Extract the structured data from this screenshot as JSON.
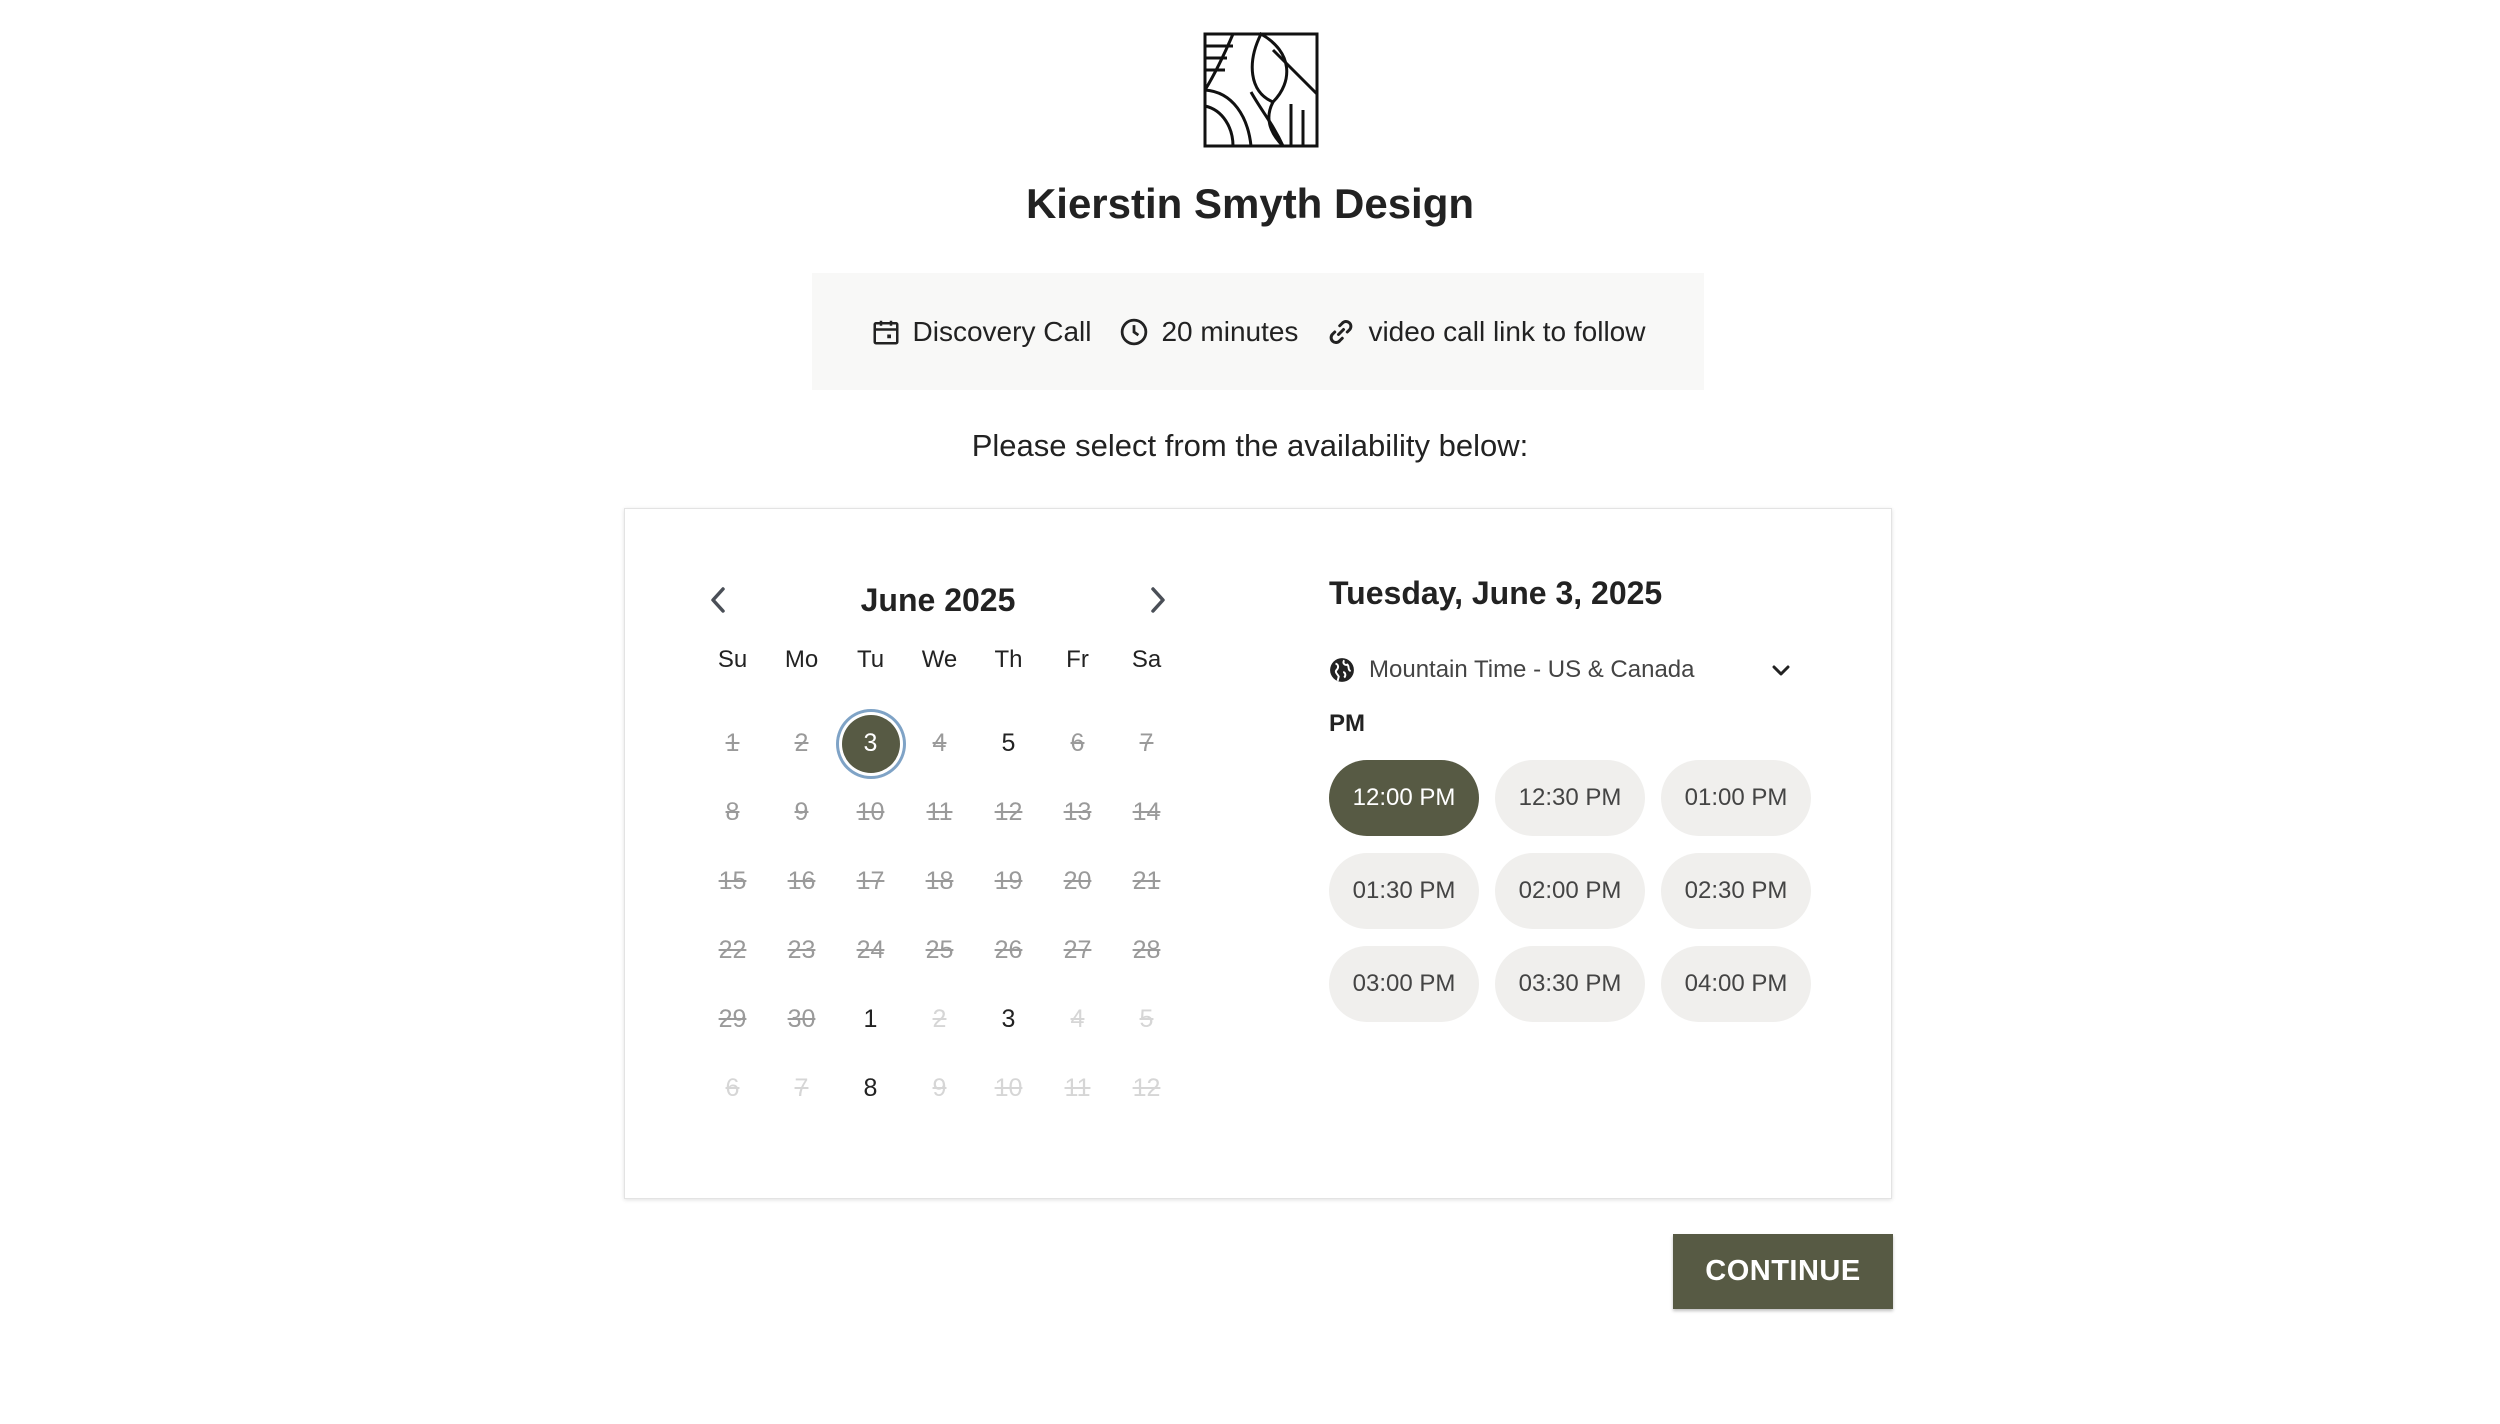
{
  "brand": {
    "name": "Kierstin Smyth Design",
    "logo_icon": "geometric-monogram-logo"
  },
  "meeting": {
    "type_icon": "calendar-icon",
    "type": "Discovery Call",
    "duration_icon": "clock-icon",
    "duration": "20 minutes",
    "location_icon": "link-icon",
    "location": "video call link to follow"
  },
  "instruction": "Please select from the availability below:",
  "calendar": {
    "month_label": "June 2025",
    "prev_icon": "chevron-left-icon",
    "next_icon": "chevron-right-icon",
    "weekdays": [
      "Su",
      "Mo",
      "Tu",
      "We",
      "Th",
      "Fr",
      "Sa"
    ],
    "days": [
      {
        "label": "1",
        "state": "unavail",
        "month": "current"
      },
      {
        "label": "2",
        "state": "unavail",
        "month": "current"
      },
      {
        "label": "3",
        "state": "selected",
        "month": "current"
      },
      {
        "label": "4",
        "state": "unavail",
        "month": "current"
      },
      {
        "label": "5",
        "state": "avail",
        "month": "current"
      },
      {
        "label": "6",
        "state": "unavail",
        "month": "current"
      },
      {
        "label": "7",
        "state": "unavail",
        "month": "current"
      },
      {
        "label": "8",
        "state": "unavail",
        "month": "current"
      },
      {
        "label": "9",
        "state": "unavail",
        "month": "current"
      },
      {
        "label": "10",
        "state": "unavail",
        "month": "current"
      },
      {
        "label": "11",
        "state": "unavail",
        "month": "current"
      },
      {
        "label": "12",
        "state": "unavail",
        "month": "current"
      },
      {
        "label": "13",
        "state": "unavail",
        "month": "current"
      },
      {
        "label": "14",
        "state": "unavail",
        "month": "current"
      },
      {
        "label": "15",
        "state": "unavail",
        "month": "current"
      },
      {
        "label": "16",
        "state": "unavail",
        "month": "current"
      },
      {
        "label": "17",
        "state": "unavail",
        "month": "current"
      },
      {
        "label": "18",
        "state": "unavail",
        "month": "current"
      },
      {
        "label": "19",
        "state": "unavail",
        "month": "current"
      },
      {
        "label": "20",
        "state": "unavail",
        "month": "current"
      },
      {
        "label": "21",
        "state": "unavail",
        "month": "current"
      },
      {
        "label": "22",
        "state": "unavail",
        "month": "current"
      },
      {
        "label": "23",
        "state": "unavail",
        "month": "current"
      },
      {
        "label": "24",
        "state": "unavail",
        "month": "current"
      },
      {
        "label": "25",
        "state": "unavail",
        "month": "current"
      },
      {
        "label": "26",
        "state": "unavail",
        "month": "current"
      },
      {
        "label": "27",
        "state": "unavail",
        "month": "current"
      },
      {
        "label": "28",
        "state": "unavail",
        "month": "current"
      },
      {
        "label": "29",
        "state": "unavail",
        "month": "current"
      },
      {
        "label": "30",
        "state": "unavail",
        "month": "current"
      },
      {
        "label": "1",
        "state": "avail",
        "month": "other"
      },
      {
        "label": "2",
        "state": "unavail",
        "month": "other"
      },
      {
        "label": "3",
        "state": "avail",
        "month": "other"
      },
      {
        "label": "4",
        "state": "unavail",
        "month": "other"
      },
      {
        "label": "5",
        "state": "unavail",
        "month": "other"
      },
      {
        "label": "6",
        "state": "unavail",
        "month": "other"
      },
      {
        "label": "7",
        "state": "unavail",
        "month": "other"
      },
      {
        "label": "8",
        "state": "avail",
        "month": "other"
      },
      {
        "label": "9",
        "state": "unavail",
        "month": "other"
      },
      {
        "label": "10",
        "state": "unavail",
        "month": "other"
      },
      {
        "label": "11",
        "state": "unavail",
        "month": "other"
      },
      {
        "label": "12",
        "state": "unavail",
        "month": "other"
      }
    ]
  },
  "schedule": {
    "date_title": "Tuesday, June 3, 2025",
    "timezone_icon": "globe-icon",
    "timezone": "Mountain Time - US & Canada",
    "timezone_chevron": "chevron-down-icon",
    "period": "PM",
    "slots": [
      {
        "label": "12:00 PM",
        "selected": true
      },
      {
        "label": "12:30 PM",
        "selected": false
      },
      {
        "label": "01:00 PM",
        "selected": false
      },
      {
        "label": "01:30 PM",
        "selected": false
      },
      {
        "label": "02:00 PM",
        "selected": false
      },
      {
        "label": "02:30 PM",
        "selected": false
      },
      {
        "label": "03:00 PM",
        "selected": false
      },
      {
        "label": "03:30 PM",
        "selected": false
      },
      {
        "label": "04:00 PM",
        "selected": false
      }
    ]
  },
  "actions": {
    "continue_label": "CONTINUE"
  },
  "colors": {
    "accent": "#575a44",
    "selected_ring": "#7fa3c6",
    "slot_bg": "#f0efed",
    "info_bg": "#f8f8f7"
  }
}
